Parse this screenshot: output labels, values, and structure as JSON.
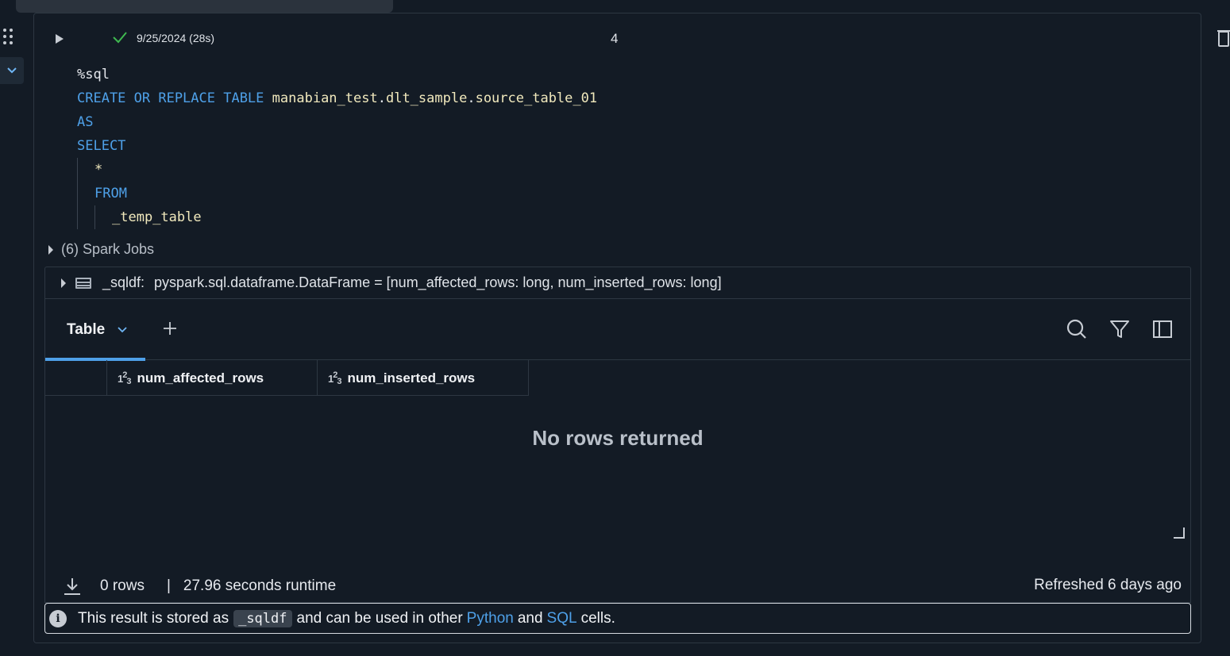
{
  "cell": {
    "status_time": "9/25/2024 (28s)",
    "number": "4",
    "code": {
      "line1": "%sql",
      "line2_kw": "CREATE OR REPLACE TABLE",
      "line2_db": "manabian_test",
      "line2_dot1": ".",
      "line2_schema": "dlt_sample",
      "line2_dot2": ".",
      "line2_table": "source_table_01",
      "line3": "AS",
      "line4": "SELECT",
      "line5": "*",
      "line6": "FROM",
      "line7": "_temp_table"
    }
  },
  "spark_jobs": {
    "label": "(6) Spark Jobs"
  },
  "dataframe": {
    "name": "_sqldf:",
    "type": "pyspark.sql.dataframe.DataFrame = [num_affected_rows: long, num_inserted_rows: long]"
  },
  "results": {
    "tab_label": "Table",
    "columns": [
      "num_affected_rows",
      "num_inserted_rows"
    ],
    "empty_message": "No rows returned"
  },
  "footer": {
    "rows": "0 rows",
    "separator": "|",
    "runtime": "27.96 seconds runtime",
    "refreshed": "Refreshed 6 days ago"
  },
  "info": {
    "prefix": "This result is stored as",
    "var": "_sqldf",
    "middle": "and can be used in other",
    "link_python": "Python",
    "and": "and",
    "link_sql": "SQL",
    "suffix": "cells."
  },
  "colors": {
    "accent": "#4ea0e8",
    "background": "#131b25",
    "success": "#3fb950"
  }
}
